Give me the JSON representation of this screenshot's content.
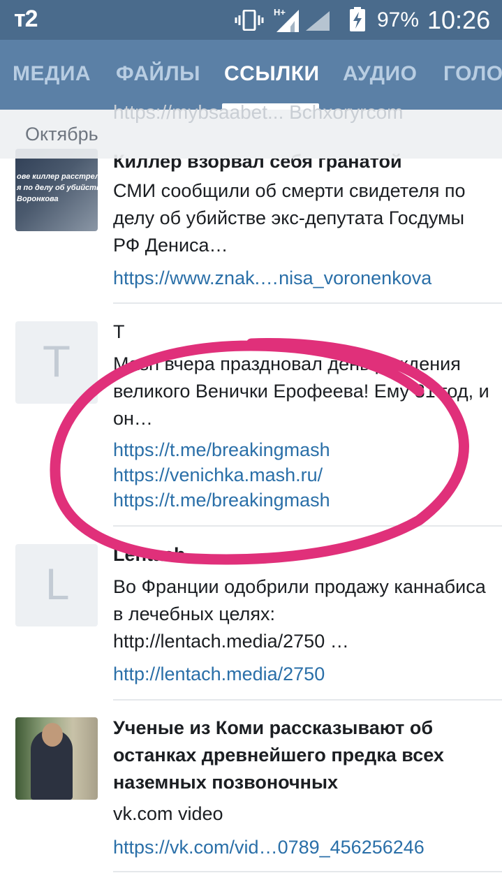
{
  "status_bar": {
    "carrier": "т2",
    "battery": "97%",
    "time": "10:26",
    "icons": [
      "vibrate-icon",
      "signal-hplus-icon",
      "signal-icon",
      "battery-charging-icon"
    ]
  },
  "tabs": [
    {
      "label": "МЕДИА"
    },
    {
      "label": "ФАЙЛЫ"
    },
    {
      "label": "ССЫЛКИ"
    },
    {
      "label": "АУДИО"
    },
    {
      "label": "ГОЛО"
    }
  ],
  "active_tab": "ССЫЛКИ",
  "section": {
    "label": "Октябрь",
    "peek_text": "https://mybsaabet... Bchxoryrcom"
  },
  "items": [
    {
      "title": "Киллер взорвал себя гранатой",
      "thumb_caption": "ове киллер расстрелял\nя по делу об убийстве\nВоронкова",
      "description": "СМИ сообщили об смерти свидетеля по делу об убийстве экс-депутата Госдумы РФ Дениса…",
      "links": [
        "https://www.znak.…nisa_voronenkova"
      ]
    },
    {
      "letter": "T",
      "title": "T",
      "description": "Mash вчера праздновал день рождения великого Венички Ерофеева! Ему 81 год, и он…",
      "links": [
        "https://t.me/breakingmash",
        "https://venichka.mash.ru/",
        "https://t.me/breakingmash"
      ]
    },
    {
      "letter": "L",
      "title": "Lentach",
      "description": "Во Франции одобрили продажу каннабиса в лечебных целях: http://lentach.media/2750 …",
      "links": [
        "http://lentach.media/2750"
      ]
    },
    {
      "title": "Ученые из Коми рассказывают об останках древнейшего предка всех наземных позвоночных",
      "description": "vk.com video",
      "links": [
        "https://vk.com/vid…0789_456256246"
      ]
    }
  ],
  "colors": {
    "status_bar": "#4a6b8c",
    "tab_bar": "#5b80a6",
    "link": "#2a6fa8",
    "annotation": "#e0307a"
  }
}
